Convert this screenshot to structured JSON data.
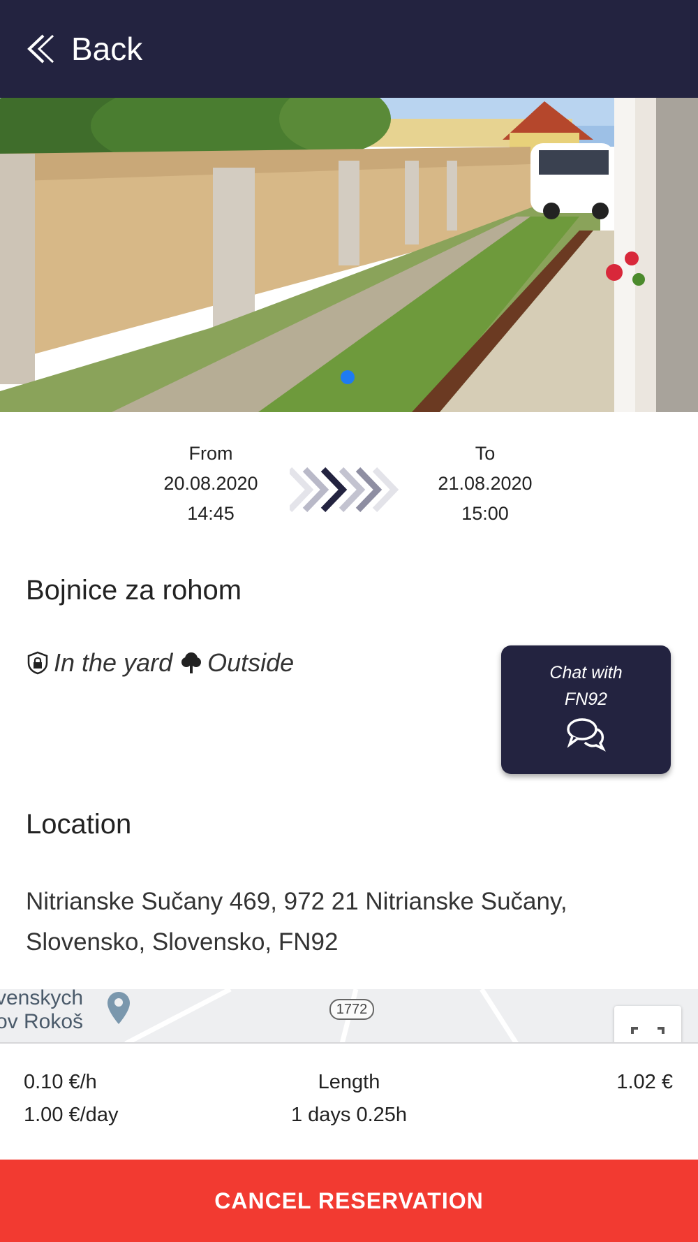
{
  "header": {
    "back_label": "Back"
  },
  "dates": {
    "from_label": "From",
    "from_date": "20.08.2020",
    "from_time": "14:45",
    "to_label": "To",
    "to_date": "21.08.2020",
    "to_time": "15:00"
  },
  "spot": {
    "title": "Bojnice za rohom",
    "features": [
      {
        "icon": "lock-shield-icon",
        "label": "In the yard"
      },
      {
        "icon": "tree-icon",
        "label": "Outside"
      }
    ]
  },
  "chat": {
    "label": "Chat with FN92",
    "icon": "chat-bubbles-icon"
  },
  "location": {
    "heading": "Location",
    "address": "Nitrianske Sučany 469, 972 21 Nitrianske Sučany, Slovensko, Slovensko, FN92"
  },
  "map": {
    "label_line1": "venskych",
    "label_line2": "ov Rokoš",
    "road_number": "1772"
  },
  "pricing": {
    "per_hour": "0.10 €/h",
    "per_day": "1.00 €/day",
    "length_label": "Length",
    "length_value": "1 days 0.25h",
    "total": "1.02 €"
  },
  "actions": {
    "cancel_label": "CANCEL RESERVATION"
  },
  "colors": {
    "header_bg": "#232340",
    "accent_red": "#f23a31",
    "dot_blue": "#1e7bf2"
  }
}
